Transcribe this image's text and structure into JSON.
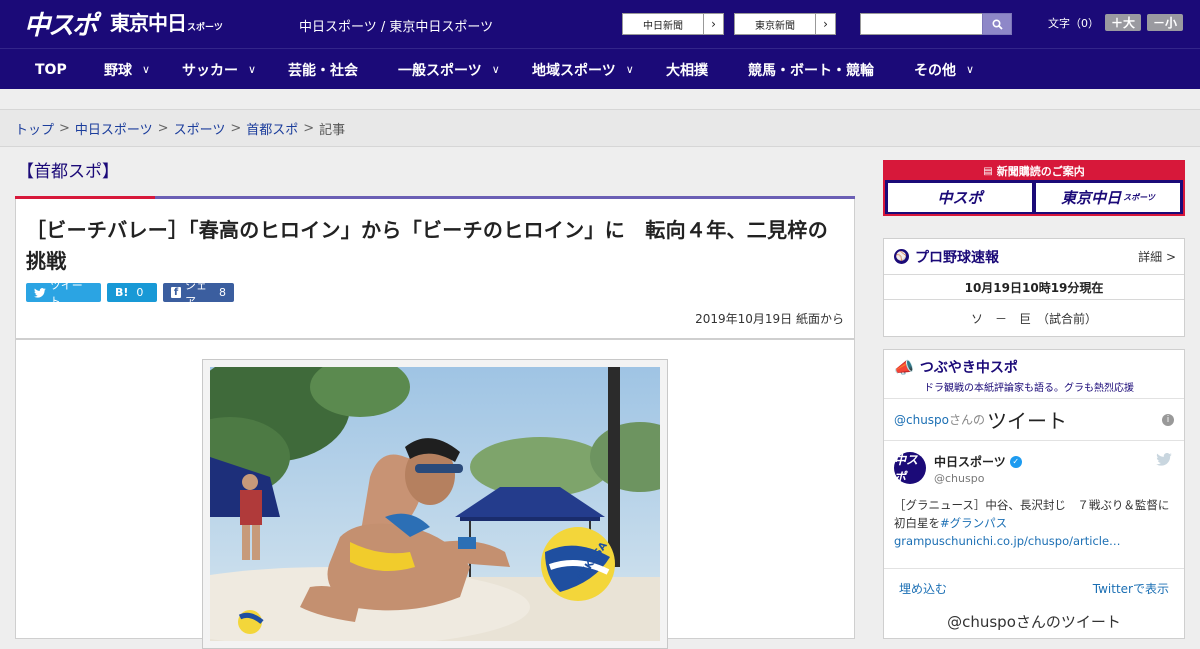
{
  "header": {
    "logo_chuspo": "中スポ",
    "logo_tokyo": "東京中日",
    "logo_tokyo_suffix": "スポーツ",
    "site_title": "中日スポーツ / 東京中日スポーツ",
    "paper_buttons": [
      {
        "label": "中日新聞"
      },
      {
        "label": "東京新聞"
      }
    ],
    "search_placeholder": "",
    "fontsize_label": "文字（0）",
    "fontsize_bigger": "＋大",
    "fontsize_smaller": "－小"
  },
  "nav": {
    "items": [
      {
        "label": "TOP",
        "dropdown": false
      },
      {
        "label": "野球",
        "dropdown": true
      },
      {
        "label": "サッカー",
        "dropdown": true
      },
      {
        "label": "芸能・社会",
        "dropdown": false
      },
      {
        "label": "一般スポーツ",
        "dropdown": true
      },
      {
        "label": "地域スポーツ",
        "dropdown": true
      },
      {
        "label": "大相撲",
        "dropdown": false
      },
      {
        "label": "競馬・ボート・競輪",
        "dropdown": false
      },
      {
        "label": "その他",
        "dropdown": true
      }
    ]
  },
  "breadcrumb": {
    "links": [
      "トップ",
      "中日スポーツ",
      "スポーツ",
      "首都スポ"
    ],
    "current": "記事",
    "separator": ">"
  },
  "article": {
    "section": "【首都スポ】",
    "headline": "［ビーチバレー］「春高のヒロイン」から「ビーチのヒロイン」に　転向４年、二見梓の挑戦",
    "share": {
      "tweet_label": "ツイート",
      "hatena_label": "B!",
      "hatena_count": "0",
      "facebook_label": "シェア",
      "facebook_count": "8"
    },
    "dateline": "2019年10月19日 紙面から",
    "photo_ball_text": "MIKASA"
  },
  "sidebar": {
    "subscribe": {
      "title": "新聞購読のご案内",
      "logo1": "中スポ",
      "logo2": "東京中日",
      "logo2_suffix": "スポーツ"
    },
    "baseball": {
      "title": "プロ野球速報",
      "detail": "詳細 >",
      "timestamp": "10月19日10時19分現在",
      "game": "ソ　－　巨　（試合前）"
    },
    "tsubuyaki": {
      "title": "つぶやき中スポ",
      "subtitle": "ドラ観戦の本紙評論家も語る。グラも熱烈応援",
      "tw_handle": "@chuspo",
      "tw_handle_suffix": "さんの",
      "tw_word": "ツイート",
      "tweet": {
        "name": "中日スポーツ",
        "user": "@chuspo",
        "avatar_text": "中スポ",
        "text_pre": "［グラニュース］中谷、長沢封じ　７戦ぶり＆監督に初白星を",
        "hashtag": "#グランパス",
        "link": "grampuschunichi.co.jp/chuspo/article…"
      },
      "embed_label": "埋め込む",
      "view_on_twitter": "Twitterで表示",
      "more_label": "@chuspoさんのツイート"
    }
  },
  "colors": {
    "brand_navy": "#1b0a78",
    "accent_red": "#d7183a",
    "link_blue": "#1b3d9c"
  }
}
